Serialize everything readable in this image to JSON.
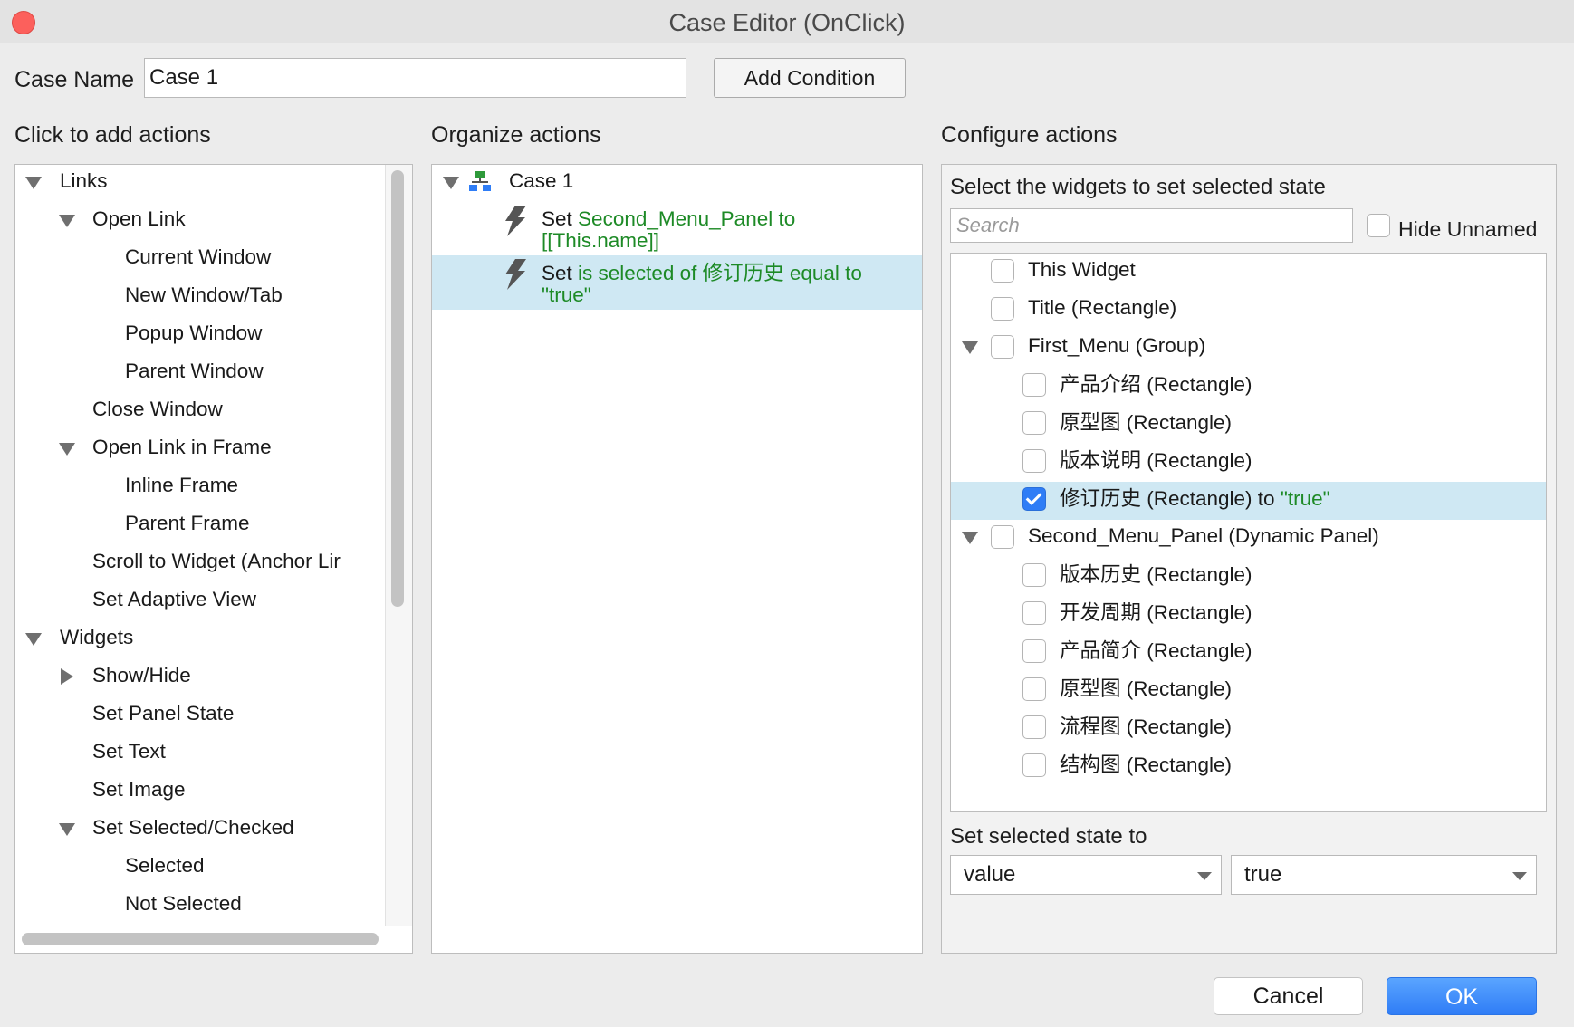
{
  "window": {
    "title": "Case Editor (OnClick)",
    "close_color": "#fc605c"
  },
  "case_name": {
    "label": "Case Name",
    "value": "Case 1",
    "add_condition_label": "Add Condition"
  },
  "left": {
    "heading": "Click to add actions",
    "items": [
      {
        "label": "Links",
        "expander": "down"
      },
      {
        "label": "Open Link",
        "expander": "down"
      },
      {
        "label": "Current Window"
      },
      {
        "label": "New Window/Tab"
      },
      {
        "label": "Popup Window"
      },
      {
        "label": "Parent Window"
      },
      {
        "label": "Close Window"
      },
      {
        "label": "Open Link in Frame",
        "expander": "down"
      },
      {
        "label": "Inline Frame"
      },
      {
        "label": "Parent Frame"
      },
      {
        "label": "Scroll to Widget (Anchor Lir"
      },
      {
        "label": "Set Adaptive View"
      },
      {
        "label": "Widgets",
        "expander": "down"
      },
      {
        "label": "Show/Hide",
        "expander": "right"
      },
      {
        "label": "Set Panel State"
      },
      {
        "label": "Set Text"
      },
      {
        "label": "Set Image"
      },
      {
        "label": "Set Selected/Checked",
        "expander": "down"
      },
      {
        "label": "Selected"
      },
      {
        "label": "Not Selected"
      }
    ]
  },
  "middle": {
    "heading": "Organize actions",
    "case_label": "Case 1",
    "actions": [
      {
        "prefix": "Set",
        "line1": "Second_Menu_Panel to",
        "line2": "[[This.name]]"
      },
      {
        "prefix": "Set",
        "line1": "is selected of 修订历史 equal to",
        "line2": "\"true\""
      }
    ]
  },
  "right": {
    "heading": "Configure actions",
    "subheading": "Select the widgets to set selected state",
    "search_placeholder": "Search",
    "hide_unnamed_label": "Hide Unnamed",
    "widgets": [
      {
        "label": "This Widget",
        "checked": false
      },
      {
        "label": "Title (Rectangle)",
        "checked": false
      },
      {
        "label": "First_Menu (Group)",
        "checked": false,
        "expander": "down"
      },
      {
        "label": "产品介绍 (Rectangle)",
        "checked": false
      },
      {
        "label": "原型图 (Rectangle)",
        "checked": false
      },
      {
        "label": "版本说明 (Rectangle)",
        "checked": false
      },
      {
        "label": "修订历史 (Rectangle) to",
        "suffix": "\"true\"",
        "checked": true
      },
      {
        "label": "Second_Menu_Panel (Dynamic Panel)",
        "checked": false,
        "expander": "down"
      },
      {
        "label": "版本历史 (Rectangle)",
        "checked": false
      },
      {
        "label": "开发周期 (Rectangle)",
        "checked": false
      },
      {
        "label": "产品简介 (Rectangle)",
        "checked": false
      },
      {
        "label": "原型图 (Rectangle)",
        "checked": false
      },
      {
        "label": "流程图 (Rectangle)",
        "checked": false
      },
      {
        "label": "结构图 (Rectangle)",
        "checked": false
      }
    ],
    "state_label": "Set selected state to",
    "state_type": "value",
    "state_value": "true"
  },
  "footer": {
    "cancel_label": "Cancel",
    "ok_label": "OK",
    "ok_color": "#2f7df6"
  },
  "colors": {
    "selection": "#cfe8f3",
    "action_green": "#1d8a26",
    "checkbox_blue": "#2f7df6"
  },
  "icons": {
    "action": "lightning-icon",
    "case": "case-tree-icon"
  }
}
